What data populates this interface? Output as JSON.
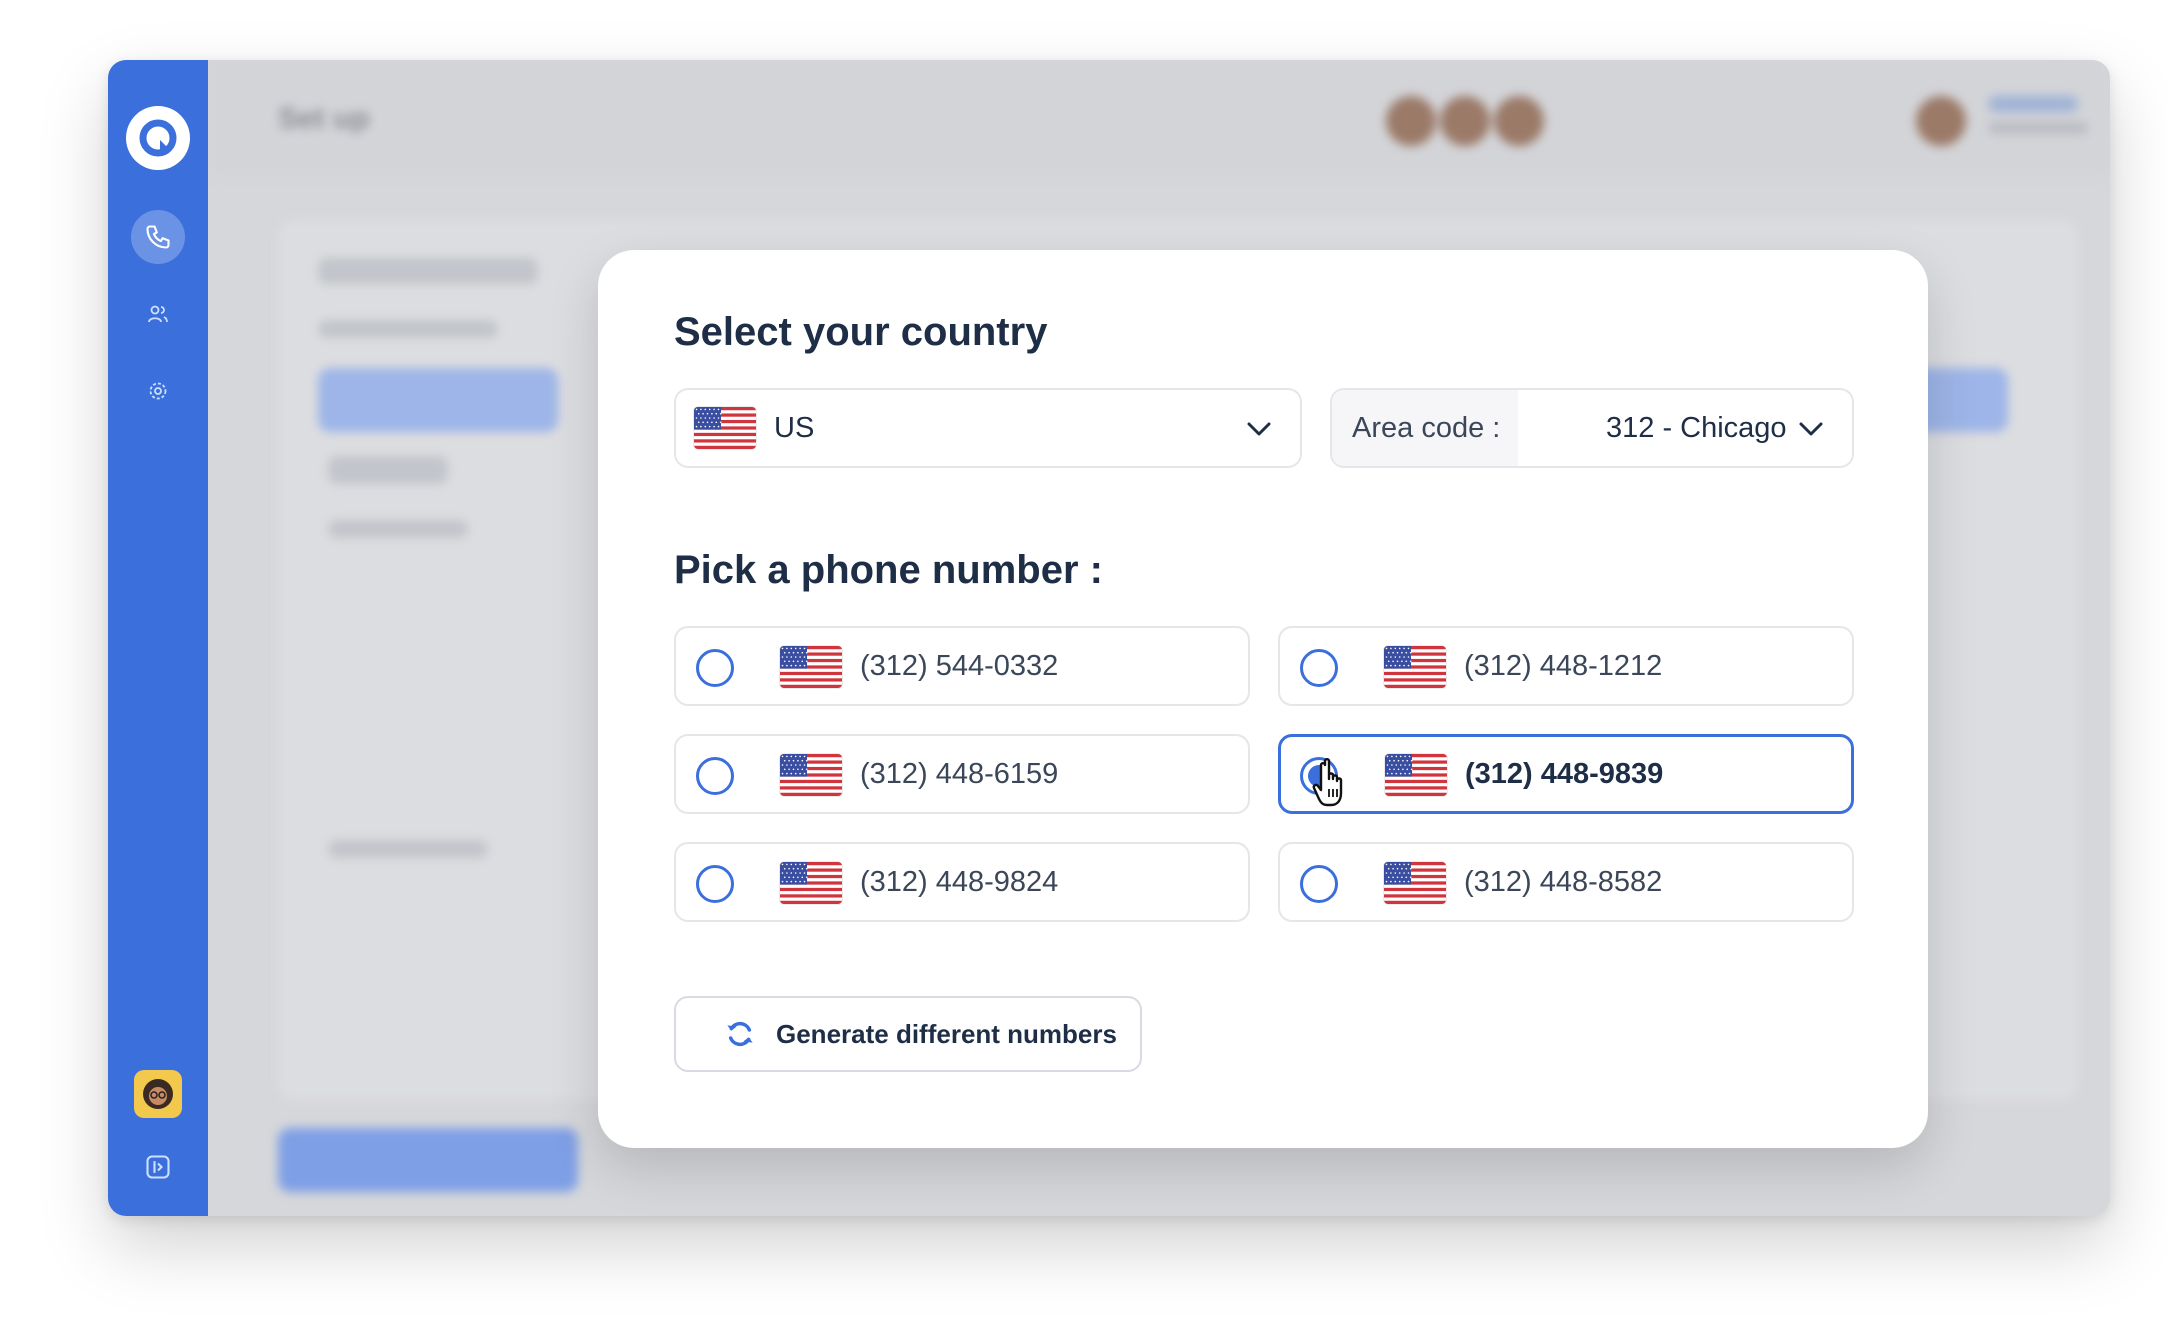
{
  "background_app": {
    "header_title": "Set up"
  },
  "modal": {
    "country_heading": "Select your country",
    "country_select": {
      "flag": "us-flag-icon",
      "value": "US"
    },
    "area_code": {
      "label": "Area code :",
      "value": "312 - Chicago"
    },
    "numbers_heading": "Pick a phone number :",
    "phone_numbers": [
      {
        "number": "(312) 544-0332",
        "selected": false
      },
      {
        "number": "(312) 448-1212",
        "selected": false
      },
      {
        "number": "(312) 448-6159",
        "selected": false
      },
      {
        "number": "(312) 448-9839",
        "selected": true
      },
      {
        "number": "(312) 448-9824",
        "selected": false
      },
      {
        "number": "(312) 448-8582",
        "selected": false
      }
    ],
    "generate_button": {
      "icon": "refresh-icon",
      "label": "Generate different numbers"
    }
  },
  "sidebar": {
    "items": [
      {
        "icon": "phone-icon",
        "active": true
      },
      {
        "icon": "users-icon",
        "active": false
      },
      {
        "icon": "gear-icon",
        "active": false
      },
      {
        "icon": "expand-sidebar-icon",
        "active": false
      }
    ]
  },
  "colors": {
    "accent": "#3a6fdc",
    "heading_text": "#1f2e47",
    "body_text": "#3b4758",
    "border": "#e4e6ea",
    "overlay": "#d6d7da"
  }
}
